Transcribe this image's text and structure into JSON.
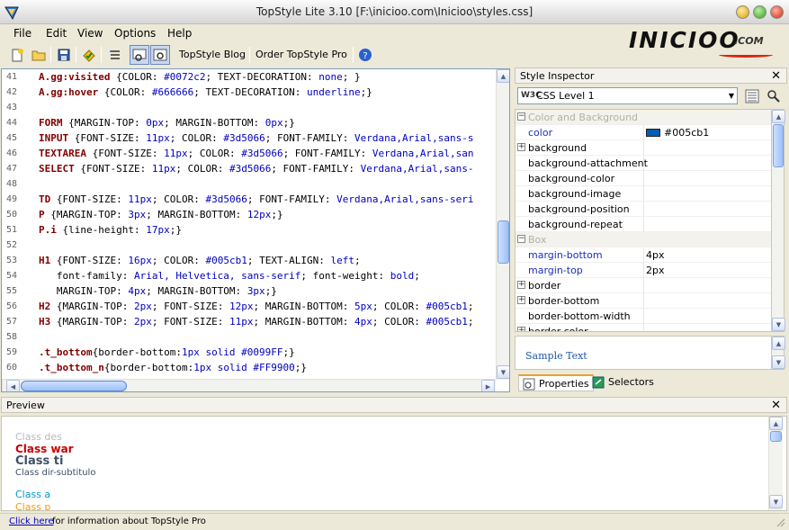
{
  "window": {
    "title": "TopStyle Lite 3.10 [F:\\inicioo.com\\Inicioo\\styles.css]"
  },
  "menu": [
    {
      "label": "File"
    },
    {
      "label": "Edit"
    },
    {
      "label": "View"
    },
    {
      "label": "Options"
    },
    {
      "label": "Help"
    }
  ],
  "logo": {
    "brand": "INICIOO",
    "domain": ".COM"
  },
  "toolbar": {
    "blog_label": "TopStyle Blog",
    "pro_label": "Order TopStyle Pro"
  },
  "editor": {
    "lines": [
      {
        "n": "41",
        "parts": [
          [
            "sel",
            "A.gg:visited "
          ],
          [
            "punc",
            "{"
          ],
          [
            "prop",
            "COLOR: "
          ],
          [
            "val",
            "#0072c2"
          ],
          [
            "prop",
            "; TEXT-DECORATION: "
          ],
          [
            "val",
            "none"
          ],
          [
            "prop",
            "; }"
          ]
        ]
      },
      {
        "n": "42",
        "parts": [
          [
            "sel",
            "A.gg:hover "
          ],
          [
            "punc",
            "{"
          ],
          [
            "prop",
            "COLOR: "
          ],
          [
            "val",
            "#666666"
          ],
          [
            "prop",
            "; TEXT-DECORATION: "
          ],
          [
            "val",
            "underline"
          ],
          [
            "prop",
            ";}"
          ]
        ]
      },
      {
        "n": "43",
        "parts": []
      },
      {
        "n": "44",
        "parts": [
          [
            "sel",
            "FORM "
          ],
          [
            "punc",
            "{"
          ],
          [
            "prop",
            "MARGIN-TOP: "
          ],
          [
            "val",
            "0px"
          ],
          [
            "prop",
            "; MARGIN-BOTTOM: "
          ],
          [
            "val",
            "0px"
          ],
          [
            "prop",
            ";}"
          ]
        ]
      },
      {
        "n": "45",
        "parts": [
          [
            "sel",
            "INPUT "
          ],
          [
            "punc",
            "{"
          ],
          [
            "prop",
            "FONT-SIZE: "
          ],
          [
            "val",
            "11px"
          ],
          [
            "prop",
            "; COLOR: "
          ],
          [
            "val",
            "#3d5066"
          ],
          [
            "prop",
            "; FONT-FAMILY: "
          ],
          [
            "val",
            "Verdana,Arial,sans-s"
          ]
        ]
      },
      {
        "n": "46",
        "parts": [
          [
            "sel",
            "TEXTAREA "
          ],
          [
            "punc",
            "{"
          ],
          [
            "prop",
            "FONT-SIZE: "
          ],
          [
            "val",
            "11px"
          ],
          [
            "prop",
            "; COLOR: "
          ],
          [
            "val",
            "#3d5066"
          ],
          [
            "prop",
            "; FONT-FAMILY: "
          ],
          [
            "val",
            "Verdana,Arial,san"
          ]
        ]
      },
      {
        "n": "47",
        "parts": [
          [
            "sel",
            "SELECT "
          ],
          [
            "punc",
            "{"
          ],
          [
            "prop",
            "FONT-SIZE: "
          ],
          [
            "val",
            "11px"
          ],
          [
            "prop",
            "; COLOR: "
          ],
          [
            "val",
            "#3d5066"
          ],
          [
            "prop",
            "; FONT-FAMILY: "
          ],
          [
            "val",
            "Verdana,Arial,sans-"
          ]
        ]
      },
      {
        "n": "48",
        "parts": []
      },
      {
        "n": "49",
        "parts": [
          [
            "sel",
            "TD "
          ],
          [
            "punc",
            "{"
          ],
          [
            "prop",
            "FONT-SIZE: "
          ],
          [
            "val",
            "11px"
          ],
          [
            "prop",
            "; COLOR: "
          ],
          [
            "val",
            "#3d5066"
          ],
          [
            "prop",
            "; FONT-FAMILY: "
          ],
          [
            "val",
            "Verdana,Arial,sans-seri"
          ]
        ]
      },
      {
        "n": "50",
        "parts": [
          [
            "sel",
            "P "
          ],
          [
            "punc",
            "{"
          ],
          [
            "prop",
            "MARGIN-TOP: "
          ],
          [
            "val",
            "3px"
          ],
          [
            "prop",
            "; MARGIN-BOTTOM: "
          ],
          [
            "val",
            "12px"
          ],
          [
            "prop",
            ";}"
          ]
        ]
      },
      {
        "n": "51",
        "parts": [
          [
            "sel",
            "P.i "
          ],
          [
            "punc",
            "{"
          ],
          [
            "prop",
            "line-height: "
          ],
          [
            "val",
            "17px"
          ],
          [
            "prop",
            ";}"
          ]
        ]
      },
      {
        "n": "52",
        "parts": []
      },
      {
        "n": "53",
        "parts": [
          [
            "sel",
            "H1 "
          ],
          [
            "punc",
            "{"
          ],
          [
            "prop",
            "FONT-SIZE: "
          ],
          [
            "val",
            "16px"
          ],
          [
            "prop",
            "; COLOR: "
          ],
          [
            "val",
            "#005cb1"
          ],
          [
            "prop",
            "; TEXT-ALIGN: "
          ],
          [
            "val",
            "left"
          ],
          [
            "prop",
            ";"
          ]
        ]
      },
      {
        "n": "54",
        "parts": [
          [
            "prop",
            "   font-family: "
          ],
          [
            "val",
            "Arial, Helvetica, sans-serif"
          ],
          [
            "prop",
            "; font-weight: "
          ],
          [
            "val",
            "bold"
          ],
          [
            "prop",
            ";"
          ]
        ]
      },
      {
        "n": "55",
        "parts": [
          [
            "prop",
            "   MARGIN-TOP: "
          ],
          [
            "val",
            "4px"
          ],
          [
            "prop",
            "; MARGIN-BOTTOM: "
          ],
          [
            "val",
            "3px"
          ],
          [
            "prop",
            ";}"
          ]
        ]
      },
      {
        "n": "56",
        "parts": [
          [
            "sel",
            "H2 "
          ],
          [
            "punc",
            "{"
          ],
          [
            "prop",
            "MARGIN-TOP: "
          ],
          [
            "val",
            "2px"
          ],
          [
            "prop",
            "; FONT-SIZE: "
          ],
          [
            "val",
            "12px"
          ],
          [
            "prop",
            "; MARGIN-BOTTOM: "
          ],
          [
            "val",
            "5px"
          ],
          [
            "prop",
            "; COLOR: "
          ],
          [
            "val",
            "#005cb1"
          ],
          [
            "prop",
            ";"
          ]
        ]
      },
      {
        "n": "57",
        "parts": [
          [
            "sel",
            "H3 "
          ],
          [
            "punc",
            "{"
          ],
          [
            "prop",
            "MARGIN-TOP: "
          ],
          [
            "val",
            "2px"
          ],
          [
            "prop",
            "; FONT-SIZE: "
          ],
          [
            "val",
            "11px"
          ],
          [
            "prop",
            "; MARGIN-BOTTOM: "
          ],
          [
            "val",
            "4px"
          ],
          [
            "prop",
            "; COLOR: "
          ],
          [
            "val",
            "#005cb1"
          ],
          [
            "prop",
            ";"
          ]
        ]
      },
      {
        "n": "58",
        "parts": []
      },
      {
        "n": "59",
        "parts": [
          [
            "sel",
            ".t_bottom"
          ],
          [
            "punc",
            "{"
          ],
          [
            "prop",
            "border-bottom:"
          ],
          [
            "val",
            "1px solid #0099FF"
          ],
          [
            "prop",
            ";}"
          ]
        ]
      },
      {
        "n": "60",
        "parts": [
          [
            "sel",
            ".t_bottom_n"
          ],
          [
            "punc",
            "{"
          ],
          [
            "prop",
            "border-bottom:"
          ],
          [
            "val",
            "1px solid #FF9900"
          ],
          [
            "prop",
            ";}"
          ]
        ]
      }
    ]
  },
  "inspector": {
    "title": "Style Inspector",
    "level": "CSS Level 1",
    "rows": [
      {
        "type": "cat",
        "name": "Color and Background"
      },
      {
        "type": "prop",
        "name": "color",
        "value": "#005cb1",
        "blue": true,
        "swatch": true
      },
      {
        "type": "prop",
        "name": "background",
        "value": "",
        "expand": true
      },
      {
        "type": "prop",
        "name": "background-attachment",
        "value": ""
      },
      {
        "type": "prop",
        "name": "background-color",
        "value": ""
      },
      {
        "type": "prop",
        "name": "background-image",
        "value": ""
      },
      {
        "type": "prop",
        "name": "background-position",
        "value": ""
      },
      {
        "type": "prop",
        "name": "background-repeat",
        "value": ""
      },
      {
        "type": "cat",
        "name": "Box"
      },
      {
        "type": "prop",
        "name": "margin-bottom",
        "value": "4px",
        "blue": true
      },
      {
        "type": "prop",
        "name": "margin-top",
        "value": "2px",
        "blue": true
      },
      {
        "type": "prop",
        "name": "border",
        "value": "",
        "expand": true
      },
      {
        "type": "prop",
        "name": "border-bottom",
        "value": "",
        "expand": true
      },
      {
        "type": "prop",
        "name": "border-bottom-width",
        "value": ""
      },
      {
        "type": "prop",
        "name": "border-color",
        "value": "",
        "expand": true
      }
    ],
    "sample_text": "Sample Text",
    "tab_properties": "Properties",
    "tab_selectors": "Selectors"
  },
  "preview": {
    "title": "Preview",
    "items": [
      {
        "text": "Class des",
        "color": "#b8b8b8",
        "size": "11px",
        "bold": false
      },
      {
        "text": "Class war",
        "color": "#cc0000",
        "size": "12px",
        "bold": true
      },
      {
        "text": "Class ti",
        "color": "#3d5066",
        "size": "13px",
        "bold": true
      },
      {
        "text": "Class dir-subtitulo",
        "color": "#3d5066",
        "size": "10px",
        "bold": false
      },
      {
        "text": "Class a",
        "color": "#0099cc",
        "size": "11px",
        "bold": false
      },
      {
        "text": "Class p",
        "color": "#ff9900",
        "size": "11px",
        "bold": false
      }
    ]
  },
  "status": {
    "link": "Click here",
    "text": "for information about TopStyle Pro"
  }
}
